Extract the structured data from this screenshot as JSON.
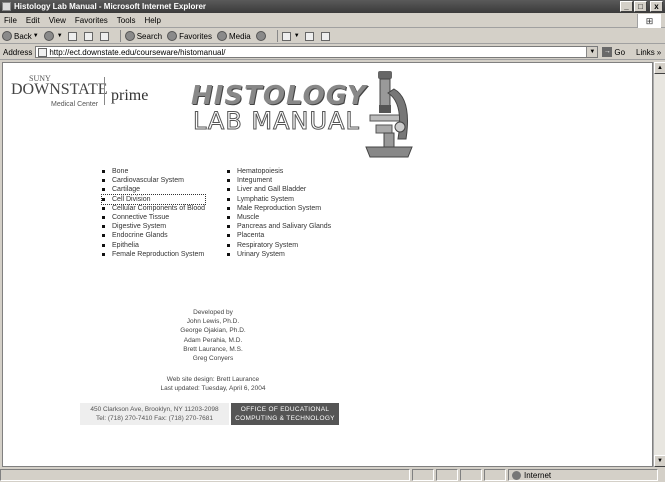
{
  "window": {
    "title": "Histology Lab Manual - Microsoft Internet Explorer",
    "min": "_",
    "max": "□",
    "close": "x"
  },
  "menu": [
    "File",
    "Edit",
    "View",
    "Favorites",
    "Tools",
    "Help"
  ],
  "toolbar": {
    "back": "Back",
    "search": "Search",
    "favorites": "Favorites",
    "media": "Media"
  },
  "address": {
    "label": "Address",
    "url": "http://ect.downstate.edu/courseware/histomanual/",
    "go": "Go",
    "links": "Links"
  },
  "header": {
    "suny": "SUNY",
    "downstate": "DOWNSTATE",
    "medical_center": "Medical Center",
    "prime": "prime",
    "title_line1": "HISTOLOGY",
    "title_line2": "LAB MANUAL"
  },
  "topics_left": [
    "Bone",
    "Cardiovascular System",
    "Cartilage",
    "Cell Division",
    "Cellular Components of Blood",
    "Connective Tissue",
    "Digestive System",
    "Endocrine Glands",
    "Epithelia",
    "Female Reproduction System"
  ],
  "topics_right": [
    "Hematopoiesis",
    "Integument",
    "Liver and Gall Bladder",
    "Lymphatic System",
    "Male Reproduction System",
    "Muscle",
    "Pancreas and Salivary Glands",
    "Placenta",
    "Respiratory System",
    "Urinary System"
  ],
  "credits": {
    "heading": "Developed by",
    "names": [
      "John Lewis, Ph.D.",
      "George Ojakian, Ph.D.",
      "Adam Perahia, M.D.",
      "Brett Laurance, M.S.",
      "Greg Conyers"
    ]
  },
  "design": {
    "line1": "Web site design: Brett Laurance",
    "line2": "Last updated: Tuesday, April 6, 2004"
  },
  "footer": {
    "address": "450 Clarkson Ave, Brooklyn, NY 11203-2098",
    "phone": "Tel: (718) 270-7410 Fax: (718) 270-7681",
    "office_line1": "OFFICE OF EDUCATIONAL",
    "office_line2": "COMPUTING & TECHNOLOGY"
  },
  "status": {
    "zone": "Internet"
  }
}
